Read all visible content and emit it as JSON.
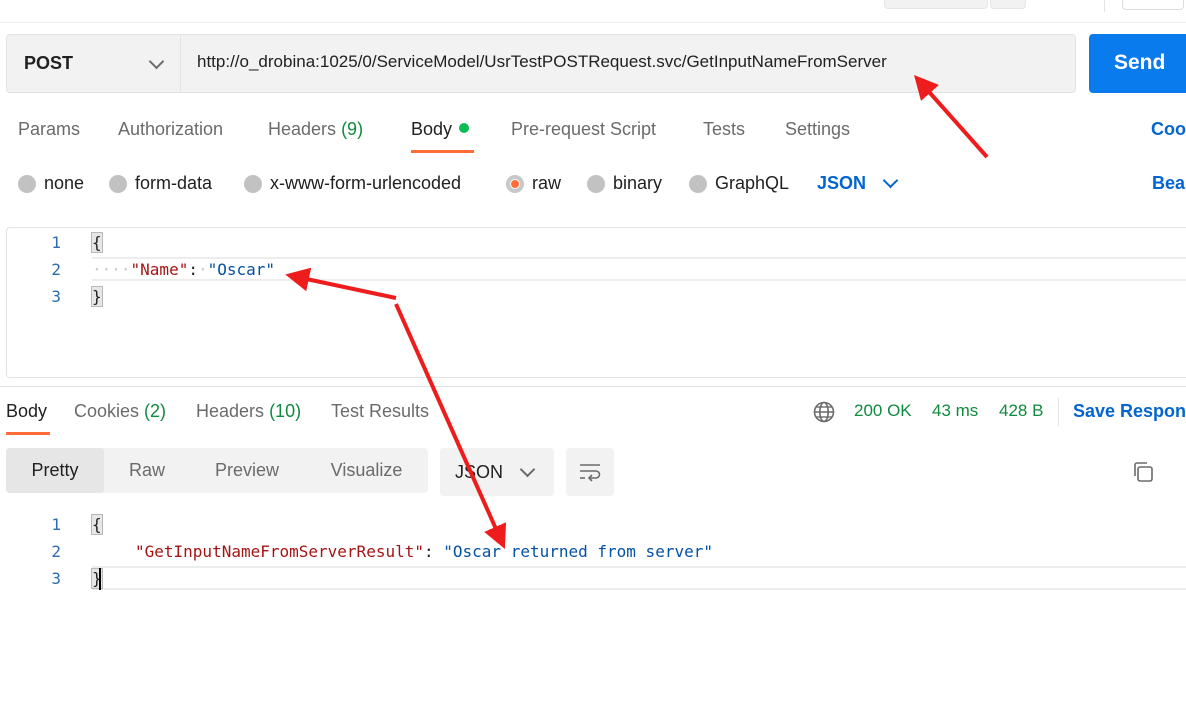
{
  "request": {
    "method": "POST",
    "url": "http://o_drobina:1025/0/ServiceModel/UsrTestPOSTRequest.svc/GetInputNameFromServer",
    "send_label": "Send"
  },
  "request_tabs": {
    "params": "Params",
    "authorization": "Authorization",
    "headers": "Headers",
    "headers_count": "(9)",
    "body": "Body",
    "prerequest": "Pre-request Script",
    "tests": "Tests",
    "settings": "Settings",
    "cookies_link": "Coo"
  },
  "body_types": {
    "none": "none",
    "form_data": "form-data",
    "urlencoded": "x-www-form-urlencoded",
    "raw": "raw",
    "binary": "binary",
    "graphql": "GraphQL",
    "format": "JSON",
    "beautify_link": "Beau"
  },
  "request_body": {
    "line_numbers": [
      "1",
      "2",
      "3"
    ],
    "open_brace": "{",
    "indent": "····",
    "key": "\"Name\"",
    "colon": ":",
    "value": "\"Oscar\"",
    "close_brace": "}"
  },
  "response_tabs": {
    "body": "Body",
    "cookies": "Cookies",
    "cookies_count": "(2)",
    "headers": "Headers",
    "headers_count": "(10)",
    "test_results": "Test Results"
  },
  "response_status": {
    "status": "200 OK",
    "time": "43 ms",
    "size": "428 B",
    "save_label": "Save Respon"
  },
  "view_modes": {
    "pretty": "Pretty",
    "raw": "Raw",
    "preview": "Preview",
    "visualize": "Visualize",
    "format": "JSON"
  },
  "response_body": {
    "line_numbers": [
      "1",
      "2",
      "3"
    ],
    "open_brace": "{",
    "key": "\"GetInputNameFromServerResult\"",
    "colon": ":",
    "value": "\"Oscar returned from server\"",
    "close_brace": "}"
  },
  "icons": [
    "chevron-down-icon",
    "globe-icon",
    "wrap-lines-icon",
    "copy-icon",
    "annotation-arrow"
  ],
  "colors": {
    "accent": "#ff6c37",
    "send": "#097bed",
    "link": "#0265d2",
    "success": "#0f8a3f",
    "arrow": "#ee1c1c"
  }
}
